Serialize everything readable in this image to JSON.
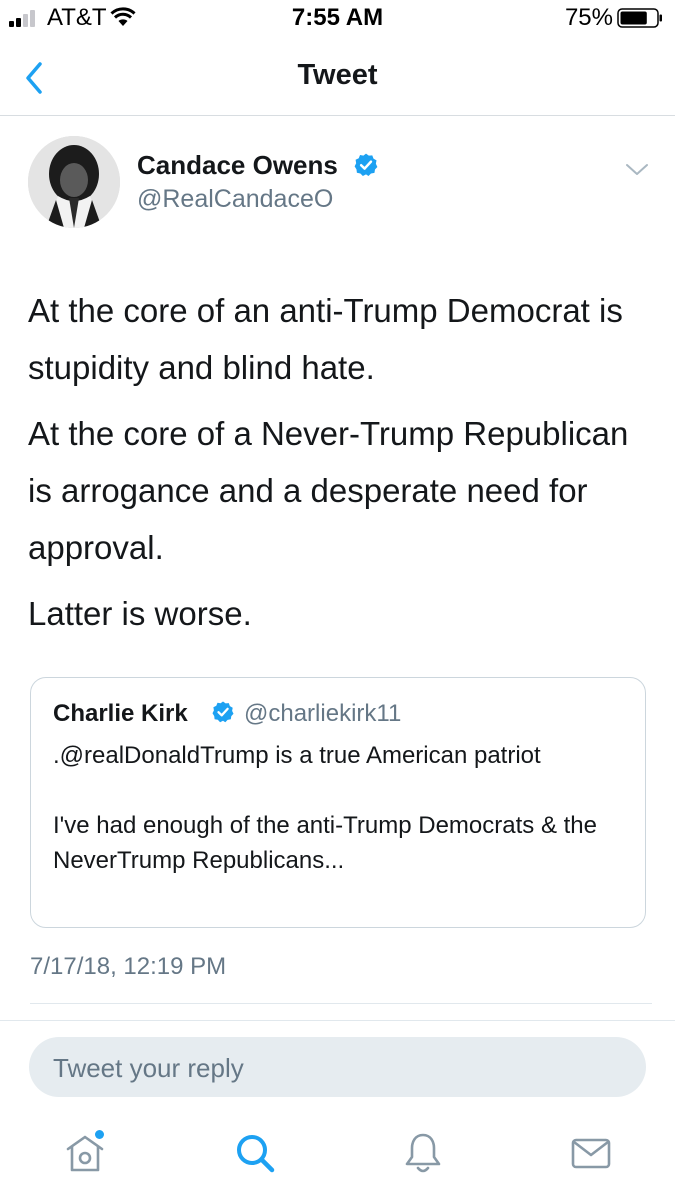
{
  "status_bar": {
    "carrier": "AT&T",
    "time": "7:55 AM",
    "battery_percent": "75%",
    "battery_level": 0.75
  },
  "nav": {
    "title": "Tweet",
    "back_icon": "chevron-left-icon"
  },
  "tweet": {
    "author_name": "Candace Owens",
    "author_handle": "@RealCandaceO",
    "verified": true,
    "paragraphs": [
      "At the core of an anti-Trump Democrat is stupidity and blind hate.",
      "At the core of a Never-Trump Republican is arrogance and a desperate need for approval.",
      "Latter is worse."
    ],
    "timestamp": "7/17/18, 12:19 PM"
  },
  "quoted_tweet": {
    "author_name": "Charlie Kirk",
    "author_handle": "@charliekirk11",
    "verified": true,
    "paragraphs": [
      ".@realDonaldTrump is a true American patriot",
      "I've had enough of the anti-Trump Democrats & the NeverTrump Republicans..."
    ]
  },
  "reply": {
    "placeholder": "Tweet your reply"
  },
  "tab_bar": {
    "items": [
      "home-icon",
      "search-icon",
      "notifications-bell-icon",
      "messages-envelope-icon"
    ],
    "active": "search-icon"
  },
  "colors": {
    "accent": "#1da1f2",
    "text": "#14171a",
    "secondary": "#657786",
    "reply_bg": "#e6ecf0"
  }
}
